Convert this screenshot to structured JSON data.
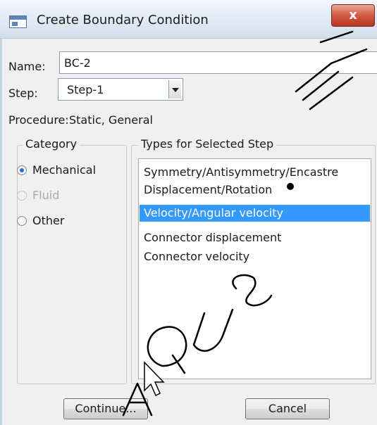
{
  "window": {
    "title": "Create Boundary Condition",
    "close_label": "x"
  },
  "form": {
    "name_label": "Name:",
    "name_value": "BC-2",
    "step_label": "Step:",
    "step_value": "Step-1",
    "procedure_label": "Procedure:",
    "procedure_value": "Static, General"
  },
  "category": {
    "title": "Category",
    "options": [
      {
        "label": "Mechanical",
        "selected": true,
        "enabled": true
      },
      {
        "label": "Fluid",
        "selected": false,
        "enabled": false
      },
      {
        "label": "Other",
        "selected": false,
        "enabled": true
      }
    ]
  },
  "types": {
    "title": "Types for Selected Step",
    "items": [
      {
        "label": "Symmetry/Antisymmetry/Encastre",
        "selected": false
      },
      {
        "label": "Displacement/Rotation",
        "selected": false
      },
      {
        "label": "Velocity/Angular velocity",
        "selected": true
      },
      {
        "label": "Connector displacement",
        "selected": false
      },
      {
        "label": "Connector velocity",
        "selected": false
      }
    ]
  },
  "buttons": {
    "continue_label": "Continue...",
    "cancel_label": "Cancel"
  },
  "colors": {
    "selection": "#3399ff",
    "dialog_bg": "#f0f0f0",
    "close_red": "#c94a32"
  }
}
